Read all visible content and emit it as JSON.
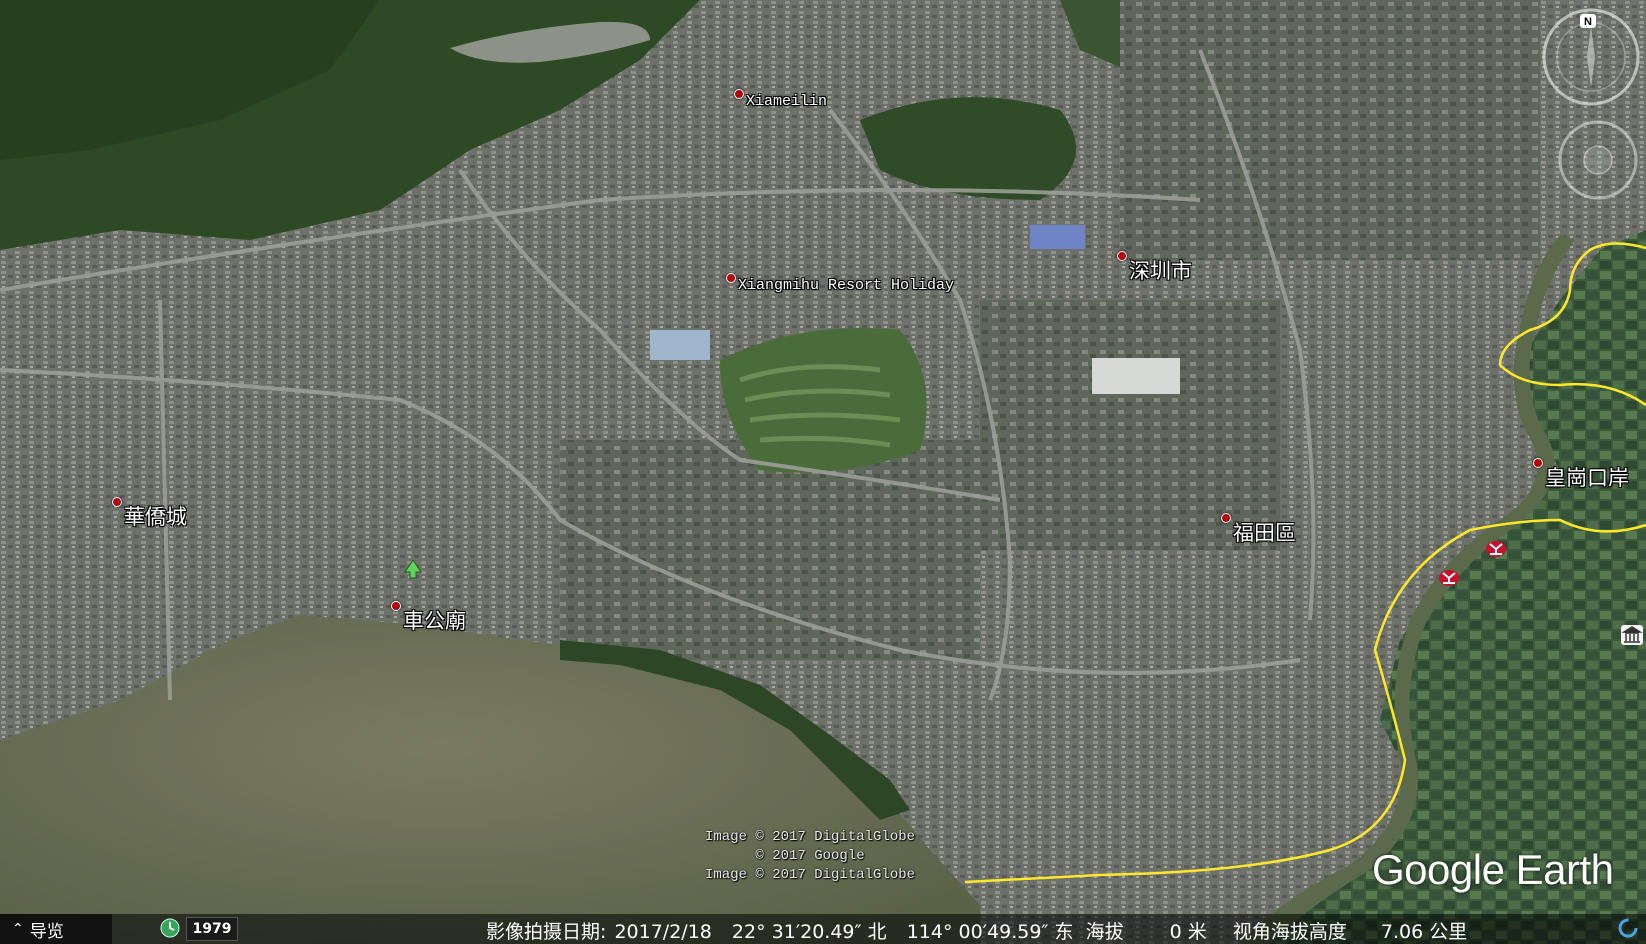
{
  "app": {
    "name": "Google Earth"
  },
  "places": [
    {
      "id": "xiameilin",
      "label": "Xiameilin",
      "script": "latin"
    },
    {
      "id": "xiangmihu",
      "label": "Xiangmihu Resort Holiday",
      "script": "latin"
    },
    {
      "id": "shenzhen",
      "label": "深圳市",
      "script": "cjk"
    },
    {
      "id": "huaqiaocheng",
      "label": "華僑城",
      "script": "cjk"
    },
    {
      "id": "chegongmiao",
      "label": "車公廟",
      "script": "cjk"
    },
    {
      "id": "futian",
      "label": "福田區",
      "script": "cjk"
    },
    {
      "id": "huanggang",
      "label": "皇崗口岸",
      "script": "cjk"
    }
  ],
  "attribution": {
    "line1": "Image © 2017 DigitalGlobe",
    "line2": "© 2017 Google",
    "line3": "Image © 2017 DigitalGlobe"
  },
  "logo": {
    "text": "Google Earth"
  },
  "statusbar": {
    "nav_label": "导览",
    "history_year": "1979",
    "imagery_date_label": "影像拍摄日期:",
    "imagery_date": "2017/2/18",
    "lat": "22° 31′20.49″ 北",
    "lon": "114° 00′49.59″ 东",
    "elevation_label": "海拔",
    "elevation": "0 米",
    "eye_alt_label": "视角海拔高度",
    "eye_alt": "7.06 公里"
  },
  "colors": {
    "boundary_line": "#ffe82a",
    "pin": "#b00010",
    "water": "#5e6a4c",
    "forest": "#2c4a22",
    "urban": "#7a7d78"
  },
  "icons": {
    "navigation": "chevron-up-icon",
    "history": "clock-icon",
    "loading": "loading-icon",
    "compass": "compass-icon",
    "look": "look-joystick-icon",
    "park": "tree-icon",
    "border_checkpoint": "hk-mtr-icon",
    "museum": "museum-icon"
  }
}
